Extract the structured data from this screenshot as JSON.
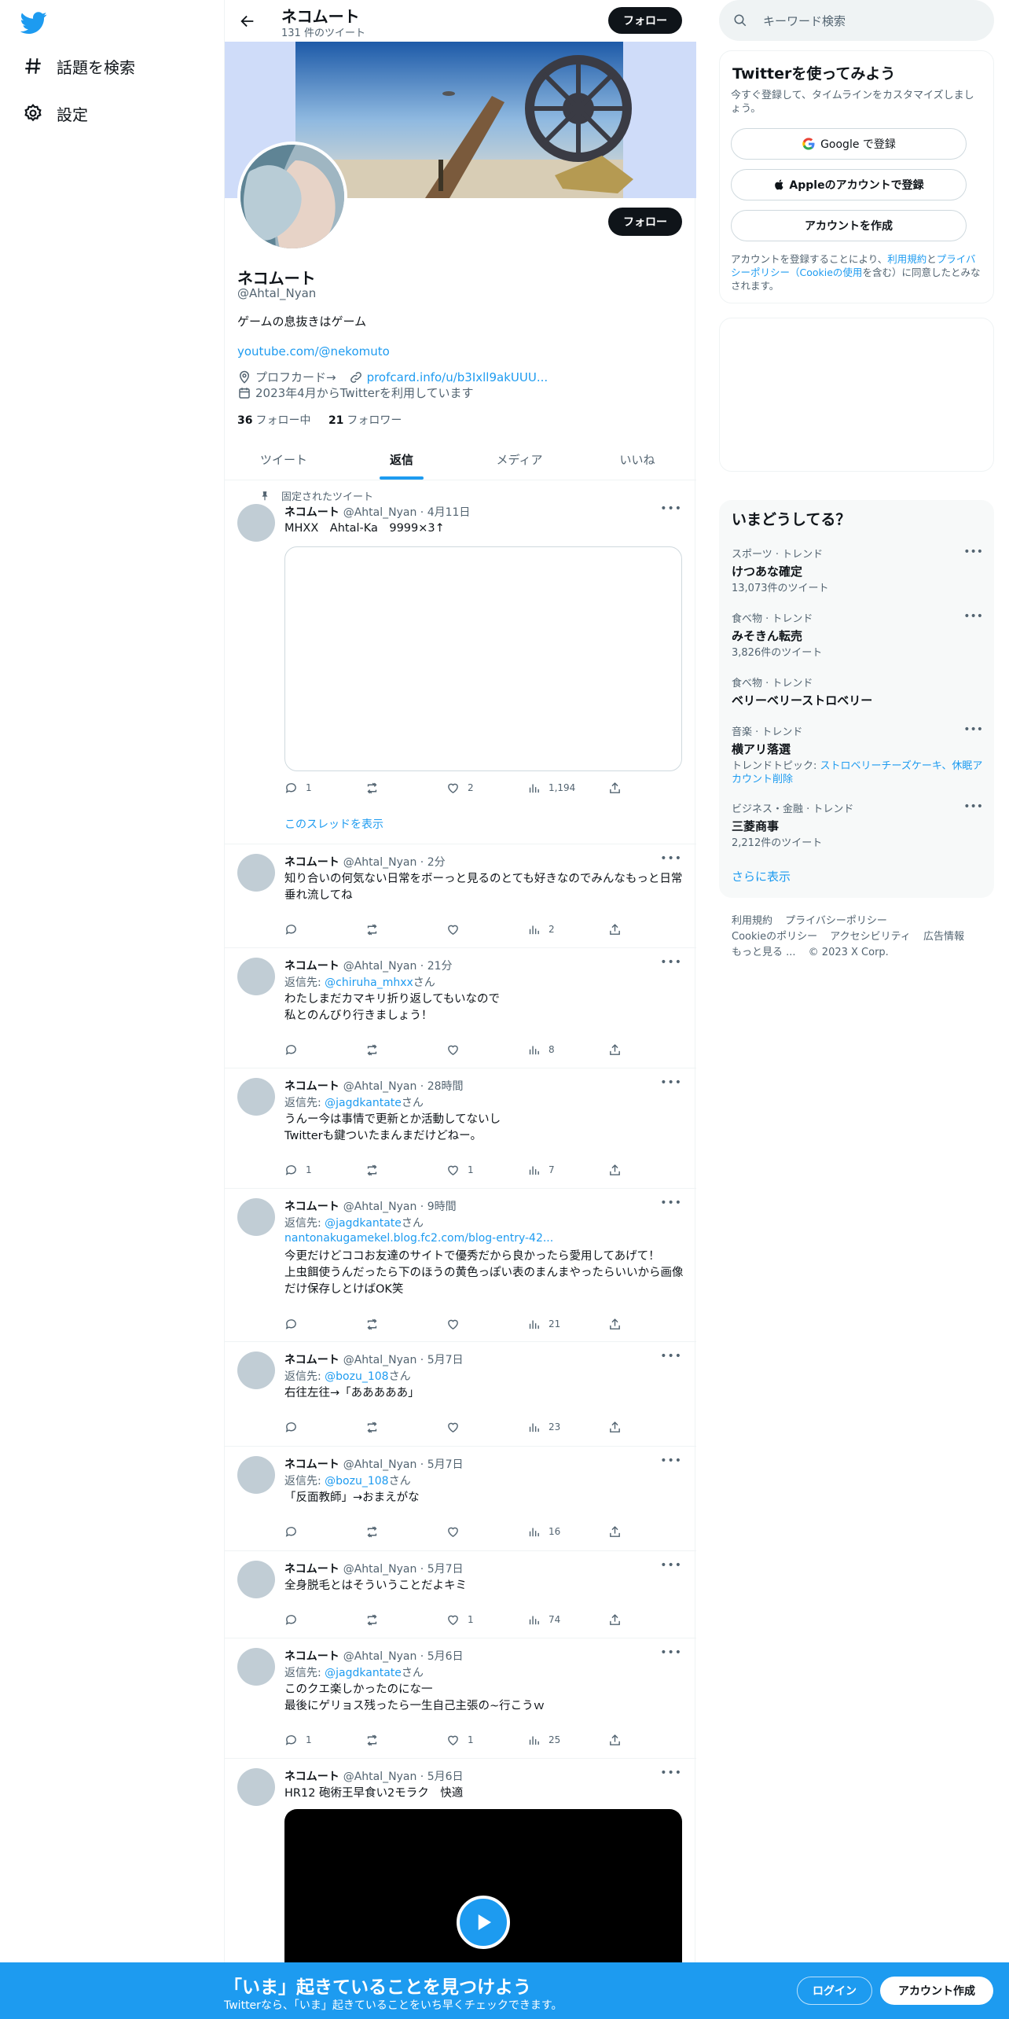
{
  "nav": {
    "explore_label": "話題を検索",
    "settings_label": "設定"
  },
  "header": {
    "name": "ネコムート",
    "tweet_count": "131 件のツイート",
    "follow_label": "フォロー"
  },
  "profile": {
    "name": "ネコムート",
    "handle": "@Ahtal_Nyan",
    "bio": "ゲームの息抜きはゲーム",
    "link": "youtube.com/@nekomuto",
    "location": "プロフカード→",
    "url": "profcard.info/u/b3Ixll9akUUU...",
    "joined": "2023年4月からTwitterを利用しています",
    "following_count": "36",
    "following_label": "フォロー中",
    "followers_count": "21",
    "followers_label": "フォロワー",
    "follow_label": "フォロー"
  },
  "tabs": [
    {
      "label": "ツイート"
    },
    {
      "label": "返信"
    },
    {
      "label": "メディア"
    },
    {
      "label": "いいね"
    }
  ],
  "tweets": [
    {
      "pinned": "固定されたツイート",
      "name": "ネコムート",
      "meta": "@Ahtal_Nyan · 4月11日",
      "text": "MHXX　Ahtal-Ka　9999×3↑",
      "reply": "1",
      "retweet": "",
      "like": "2",
      "views": "1,194",
      "thread": "このスレッドを表示"
    },
    {
      "name": "ネコムート",
      "meta": "@Ahtal_Nyan · 2分",
      "text": "知り合いの何気ない日常をボーっと見るのとても好きなのでみんなもっと日常垂れ流してね",
      "reply": "",
      "retweet": "",
      "like": "",
      "views": "2"
    },
    {
      "name": "ネコムート",
      "meta": "@Ahtal_Nyan · 21分",
      "reply_prefix": "返信先: ",
      "reply_to": "@chiruha_mhxx",
      "reply_suffix": "さん",
      "text": "わたしまだカマキリ折り返してもいなので\n私とのんびり行きましょう！",
      "reply": "",
      "retweet": "",
      "like": "",
      "views": "8"
    },
    {
      "name": "ネコムート",
      "meta": "@Ahtal_Nyan · 28時間",
      "reply_prefix": "返信先: ",
      "reply_to": "@jagdkantate",
      "reply_suffix": "さん",
      "text": "うんー今は事情で更新とか活動してないし\nTwitterも鍵ついたまんまだけどねー。",
      "reply": "1",
      "retweet": "",
      "like": "1",
      "views": "7"
    },
    {
      "name": "ネコムート",
      "meta": "@Ahtal_Nyan · 9時間",
      "reply_prefix": "返信先: ",
      "reply_to": "@jagdkantate",
      "reply_suffix": "さん",
      "link": "nantonakugamekel.blog.fc2.com/blog-entry-42...",
      "text": "今更だけどココお友達のサイトで優秀だから良かったら愛用してあげて！\n上虫餌使うんだったら下のほうの黄色っぽい表のまんまやったらいいから画像だけ保存しとけばOK笑",
      "reply": "",
      "retweet": "",
      "like": "",
      "views": "21"
    },
    {
      "name": "ネコムート",
      "meta": "@Ahtal_Nyan · 5月7日",
      "reply_prefix": "返信先: ",
      "reply_to": "@bozu_108",
      "reply_suffix": "さん",
      "text": "右往左往→「あああああ」",
      "reply": "",
      "retweet": "",
      "like": "",
      "views": "23"
    },
    {
      "name": "ネコムート",
      "meta": "@Ahtal_Nyan · 5月7日",
      "reply_prefix": "返信先: ",
      "reply_to": "@bozu_108",
      "reply_suffix": "さん",
      "text": "「反面教師」→おまえがな",
      "reply": "",
      "retweet": "",
      "like": "",
      "views": "16"
    },
    {
      "name": "ネコムート",
      "meta": "@Ahtal_Nyan · 5月7日",
      "text": "全身脱毛とはそういうことだよキミ",
      "reply": "",
      "retweet": "",
      "like": "1",
      "views": "74"
    },
    {
      "name": "ネコムート",
      "meta": "@Ahtal_Nyan · 5月6日",
      "reply_prefix": "返信先: ",
      "reply_to": "@jagdkantate",
      "reply_suffix": "さん",
      "text": "このクエ楽しかったのにな一\n最後にゲリョス残ったら一生自己主張の~行こうｗ",
      "reply": "1",
      "retweet": "",
      "like": "1",
      "views": "25"
    },
    {
      "name": "ネコムート",
      "meta": "@Ahtal_Nyan · 5月6日",
      "text": "HR12 砲術王早食い2モラク　快適"
    }
  ],
  "right": {
    "search_placeholder": "キーワード検索",
    "signup": {
      "title": "Twitterを使ってみよう",
      "desc": "今すぐ登録して、タイムラインをカスタマイズしましょう。",
      "google": "Google で登録",
      "apple": "Appleのアカウントで登録",
      "create": "アカウントを作成",
      "terms_1": "アカウントを登録することにより、",
      "terms_link1": "利用規約",
      "terms_2": "と",
      "terms_link2": "プライバシーポリシー（Cookieの使用",
      "terms_3": "を含む）に同意したとみなされます。"
    },
    "trends_title": "いまどうしてる？",
    "trends": [
      {
        "category": "スポーツ · トレンド",
        "name": "けつあな確定",
        "count": "13,073件のツイート"
      },
      {
        "category": "食べ物 · トレンド",
        "name": "みそきん転売",
        "count": "3,826件のツイート"
      },
      {
        "category": "食べ物 · トレンド",
        "name": "ベリーベリーストロベリー",
        "count": ""
      },
      {
        "category": "音楽 · トレンド",
        "name": "横アリ落選",
        "topic_prefix": "トレンドトピック: ",
        "topic": "ストロベリーチーズケーキ、休眠アカウント削除"
      },
      {
        "category": "ビジネス・金融 · トレンド",
        "name": "三菱商事",
        "count": "2,212件のツイート"
      }
    ],
    "show_more": "さらに表示",
    "footer": [
      "利用規約",
      "プライバシーポリシー",
      "Cookieのポリシー",
      "アクセシビリティ",
      "広告情報",
      "もっと見る ...",
      "© 2023 X Corp."
    ]
  },
  "bottom": {
    "title": "「いま」起きていることを見つけよう",
    "subtitle": "Twitterなら、「いま」起きていることをいち早くチェックできます。",
    "login": "ログイン",
    "signup": "アカウント作成"
  },
  "colors": {
    "accent": "#1d9bf0",
    "dark": "#0f1419",
    "muted": "#536471"
  }
}
